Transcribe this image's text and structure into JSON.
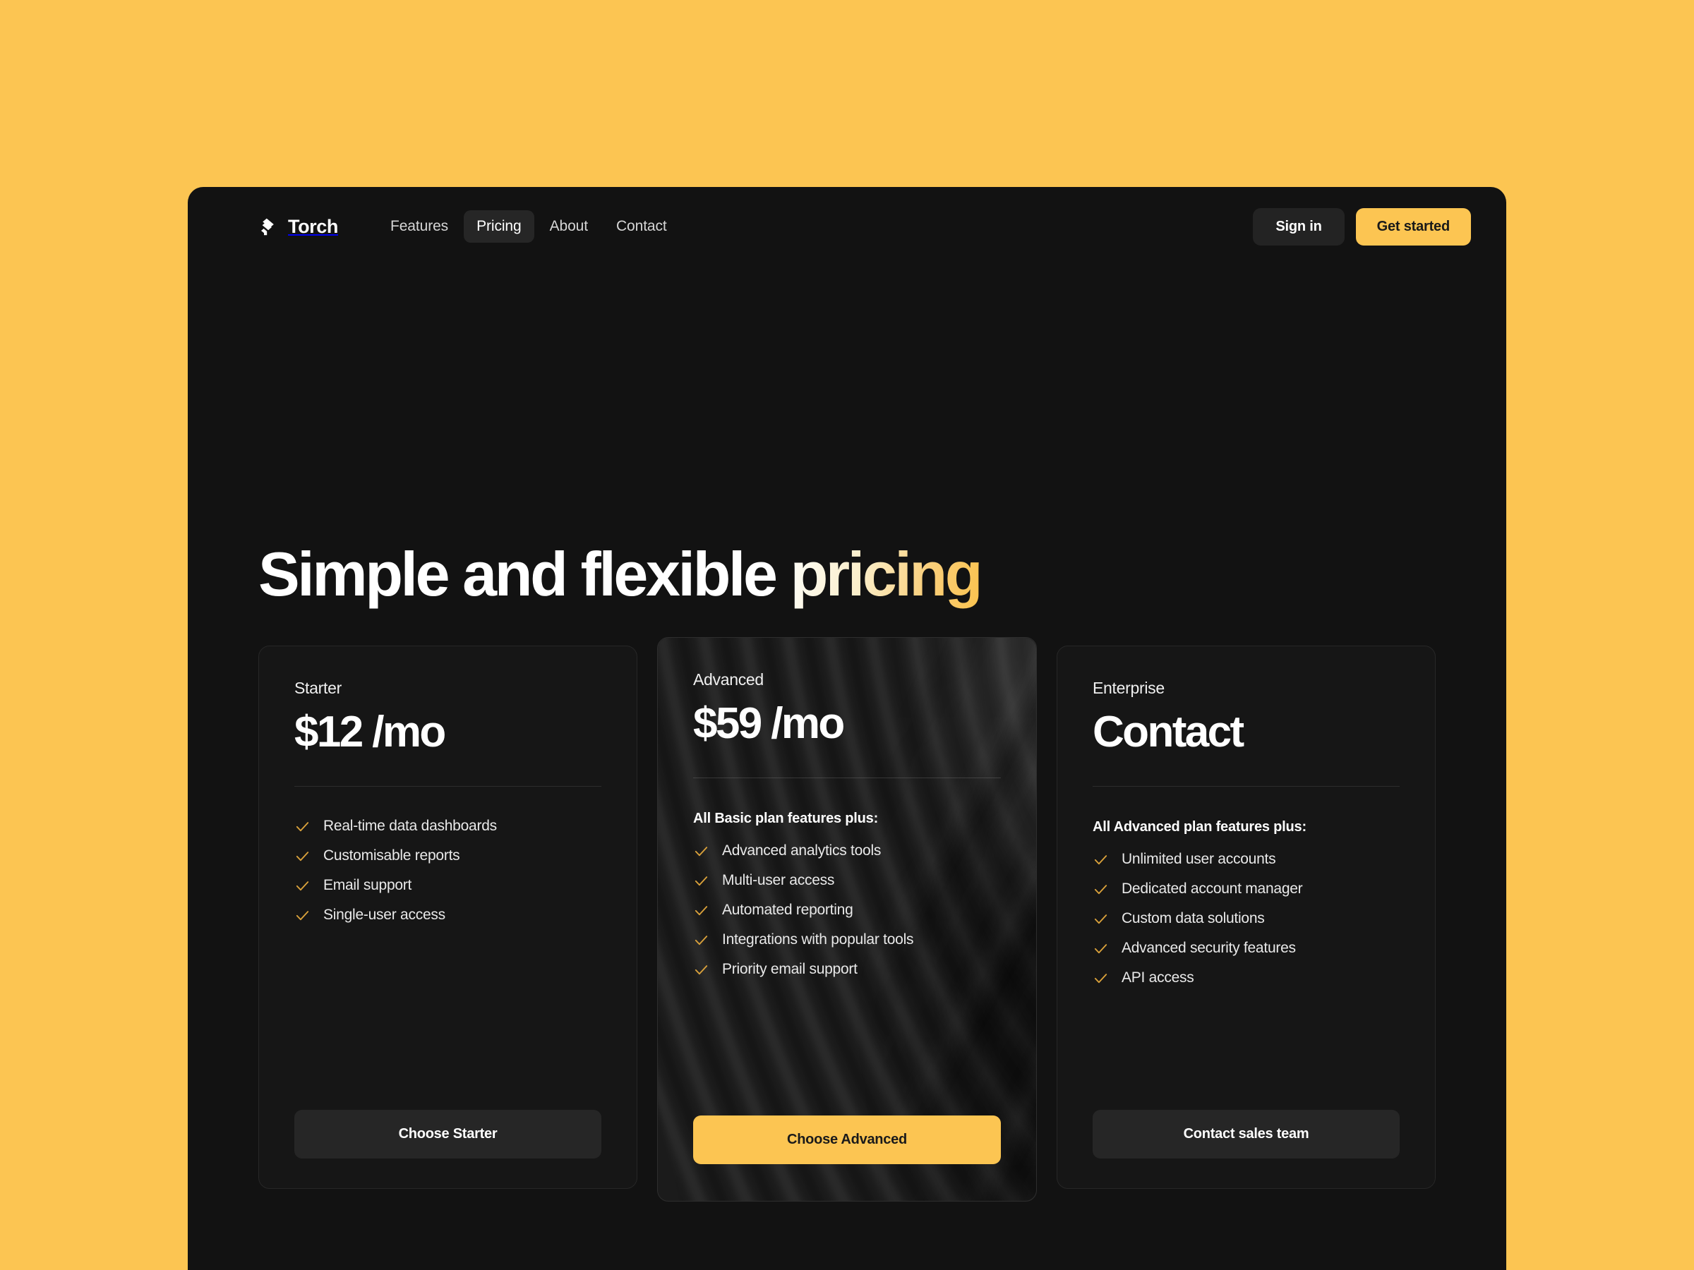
{
  "brand": {
    "name": "Torch",
    "logo_icon": "signal-waves-icon"
  },
  "nav": {
    "items": [
      {
        "label": "Features",
        "active": false
      },
      {
        "label": "Pricing",
        "active": true
      },
      {
        "label": "About",
        "active": false
      },
      {
        "label": "Contact",
        "active": false
      }
    ]
  },
  "header_actions": {
    "sign_in_label": "Sign in",
    "get_started_label": "Get started"
  },
  "hero": {
    "title_plain": "Simple and flexible ",
    "title_accent": "pricing"
  },
  "colors": {
    "page_background": "#FCC552",
    "panel_background": "#121212",
    "card_background": "#161616",
    "accent": "#FCC552",
    "check_color": "#D9A13B",
    "text_primary": "#FFFFFF",
    "text_muted": "#D6D6D6"
  },
  "plans": [
    {
      "id": "starter",
      "name": "Starter",
      "price": "$12 /mo",
      "features_intro": "",
      "features": [
        "Real-time data dashboards",
        "Customisable reports",
        "Email support",
        "Single-user access"
      ],
      "cta_label": "Choose Starter",
      "featured": false
    },
    {
      "id": "advanced",
      "name": "Advanced",
      "price": "$59 /mo",
      "features_intro": "All Basic plan features plus:",
      "features": [
        "Advanced analytics tools",
        "Multi-user access",
        "Automated reporting",
        "Integrations with popular tools",
        "Priority email support"
      ],
      "cta_label": "Choose Advanced",
      "featured": true
    },
    {
      "id": "enterprise",
      "name": "Enterprise",
      "price": "Contact",
      "features_intro": "All Advanced plan features plus:",
      "features": [
        "Unlimited user accounts",
        "Dedicated account manager",
        "Custom data solutions",
        "Advanced security features",
        "API access"
      ],
      "cta_label": "Contact sales team",
      "featured": false
    }
  ]
}
